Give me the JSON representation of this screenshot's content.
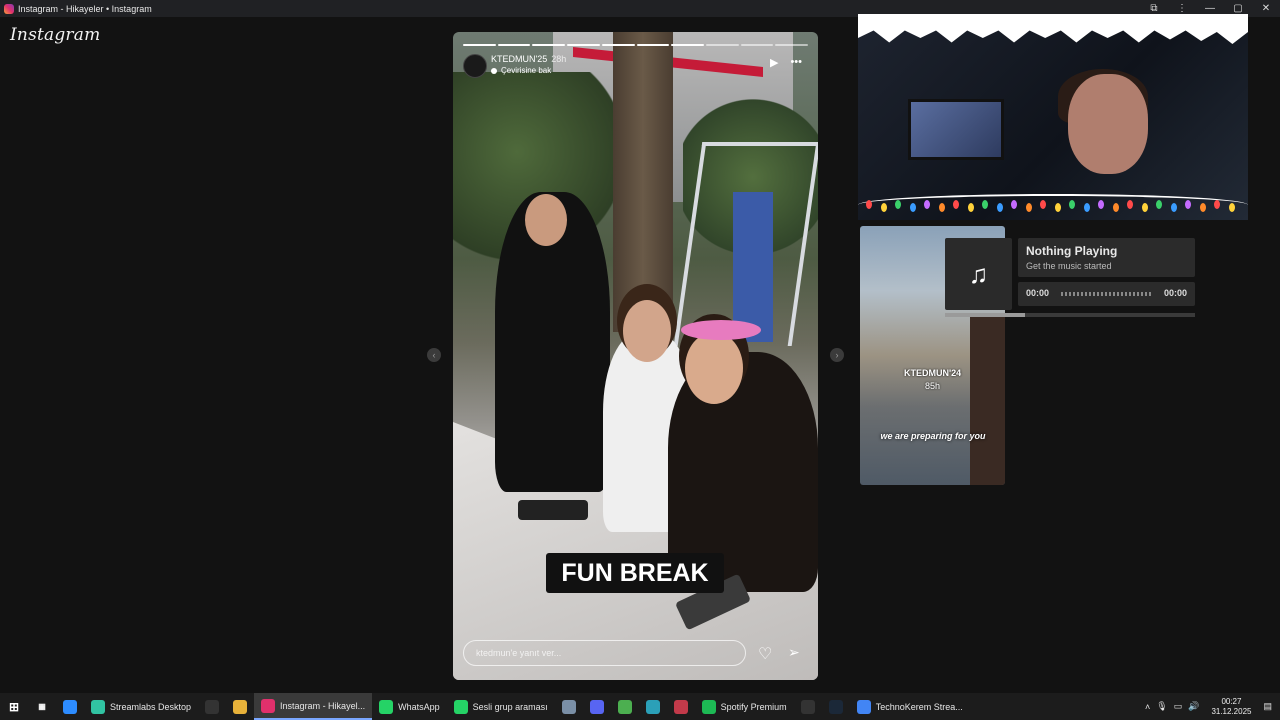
{
  "window": {
    "title": "Instagram - Hikayeler • Instagram"
  },
  "logo": "Instagram",
  "story": {
    "username": "KTEDMUN'25",
    "time": "28h",
    "subtitle": "Çevirisine bak",
    "segments_total": 10,
    "segments_done": 7,
    "sticker_text": "FUN BREAK",
    "reply_placeholder": "ktedmun'e yanıt ver..."
  },
  "music": {
    "title": "Nothing Playing",
    "subtitle": "Get the music started",
    "time_left": "00:00",
    "time_right": "00:00",
    "progress": 0.32,
    "thumb_user": "KTEDMUN'24",
    "thumb_time": "85h",
    "thumb_caption": "we are preparing for you"
  },
  "taskbar": {
    "items": [
      {
        "label": "",
        "icon": "zm-icon",
        "color": "#2d8cff"
      },
      {
        "label": "Streamlabs Desktop",
        "icon": "streamlabs-icon",
        "color": "#31c3a2"
      },
      {
        "label": "",
        "icon": "capcut-icon",
        "color": "#333333"
      },
      {
        "label": "",
        "icon": "folder-icon",
        "color": "#e8b23a"
      },
      {
        "label": "Instagram - Hikayel...",
        "icon": "instagram-icon",
        "color": "#e1306c",
        "active": true
      },
      {
        "label": "WhatsApp",
        "icon": "whatsapp-icon",
        "color": "#25d366"
      },
      {
        "label": "Sesli grup araması",
        "icon": "whatsapp-call-icon",
        "color": "#25d366"
      },
      {
        "label": "",
        "icon": "app-icon",
        "color": "#7a8fa6"
      },
      {
        "label": "",
        "icon": "discord-icon",
        "color": "#5865f2"
      },
      {
        "label": "",
        "icon": "minecraft-icon",
        "color": "#4caf50"
      },
      {
        "label": "",
        "icon": "document-icon",
        "color": "#2ba0b8"
      },
      {
        "label": "",
        "icon": "valorant-icon",
        "color": "#c23a4a"
      },
      {
        "label": "Spotify Premium",
        "icon": "spotify-icon",
        "color": "#1db954"
      },
      {
        "label": "",
        "icon": "epic-icon",
        "color": "#333333"
      },
      {
        "label": "",
        "icon": "steam-icon",
        "color": "#1b2838"
      },
      {
        "label": "TechnoKerem Strea...",
        "icon": "chrome-icon",
        "color": "#4285f4"
      }
    ],
    "time": "00:27",
    "date": "31.12.2025"
  }
}
